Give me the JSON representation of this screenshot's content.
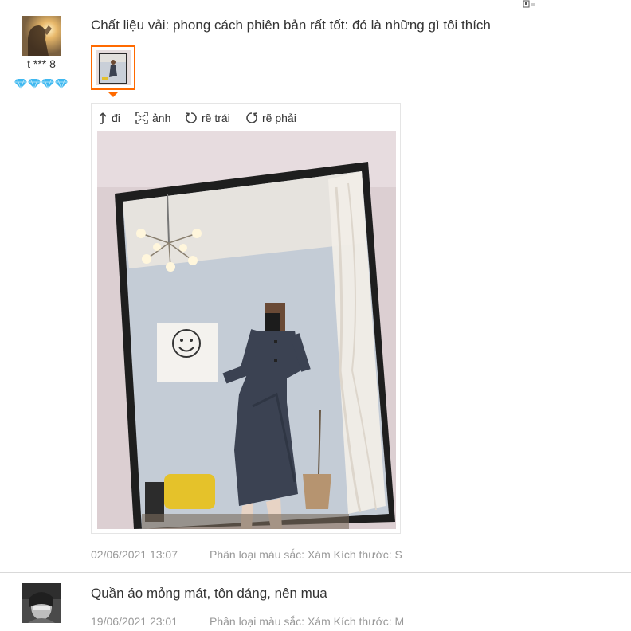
{
  "reviews": [
    {
      "username": "t *** 8",
      "rating_diamonds": 4,
      "text": "Chất liệu vải: phong cách phiên bản rất tốt: đó là những gì tôi thích",
      "date": "02/06/2021 13:07",
      "variant": "Phân loại màu sắc: Xám Kích thước: S",
      "photo_count": 1
    },
    {
      "text": "Quần áo mỏng mát, tôn dáng, nên mua",
      "date": "19/06/2021 23:01",
      "variant": "Phân loại màu sắc: Xám Kích thước: M"
    }
  ],
  "viewer": {
    "tools": [
      {
        "label": "đi",
        "icon": "collapse-arrow-icon"
      },
      {
        "label": "ảnh",
        "icon": "expand-image-icon"
      },
      {
        "label": "rẽ trái",
        "icon": "rotate-left-icon"
      },
      {
        "label": "rẽ phải",
        "icon": "rotate-right-icon"
      }
    ]
  },
  "colors": {
    "accent": "#ff6a00",
    "diamond": "#3fb8f0",
    "meta_text": "#999999"
  }
}
